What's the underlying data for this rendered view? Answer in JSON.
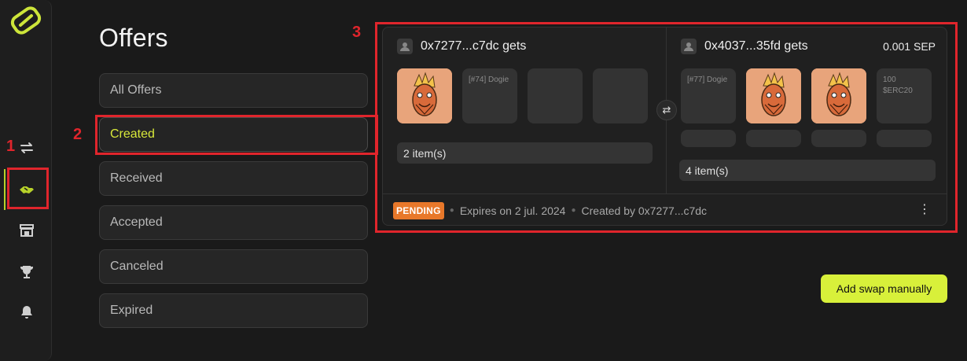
{
  "page": {
    "title": "Offers"
  },
  "sidebar": {
    "items": [
      {
        "icon": "swap-arrows-icon"
      },
      {
        "icon": "handshake-icon",
        "active": true
      },
      {
        "icon": "store-icon"
      },
      {
        "icon": "trophy-icon"
      },
      {
        "icon": "bell-icon"
      }
    ]
  },
  "filters": [
    "All Offers",
    "Created",
    "Received",
    "Accepted",
    "Canceled",
    "Expired"
  ],
  "active_filter": "Created",
  "offer": {
    "left": {
      "title": "0x7277...c7dc gets",
      "tiles": [
        "",
        "[#74] Dogie",
        "",
        ""
      ],
      "count": "2 item(s)"
    },
    "right": {
      "title": "0x4037...35fd gets",
      "price": "0.001 SEP",
      "tiles": [
        "[#77] Dogie",
        "",
        "",
        "100 $ERC20"
      ],
      "count": "4 item(s)"
    },
    "status": "PENDING",
    "expires": "Expires on 2 jul. 2024",
    "created_by": "Created by 0x7277...c7dc"
  },
  "actions": {
    "add_swap": "Add swap manually"
  },
  "annotations": [
    "1",
    "2",
    "3"
  ],
  "colors": {
    "accent": "#d8f03a",
    "pending": "#e8782a",
    "annotation": "#e0252c"
  }
}
